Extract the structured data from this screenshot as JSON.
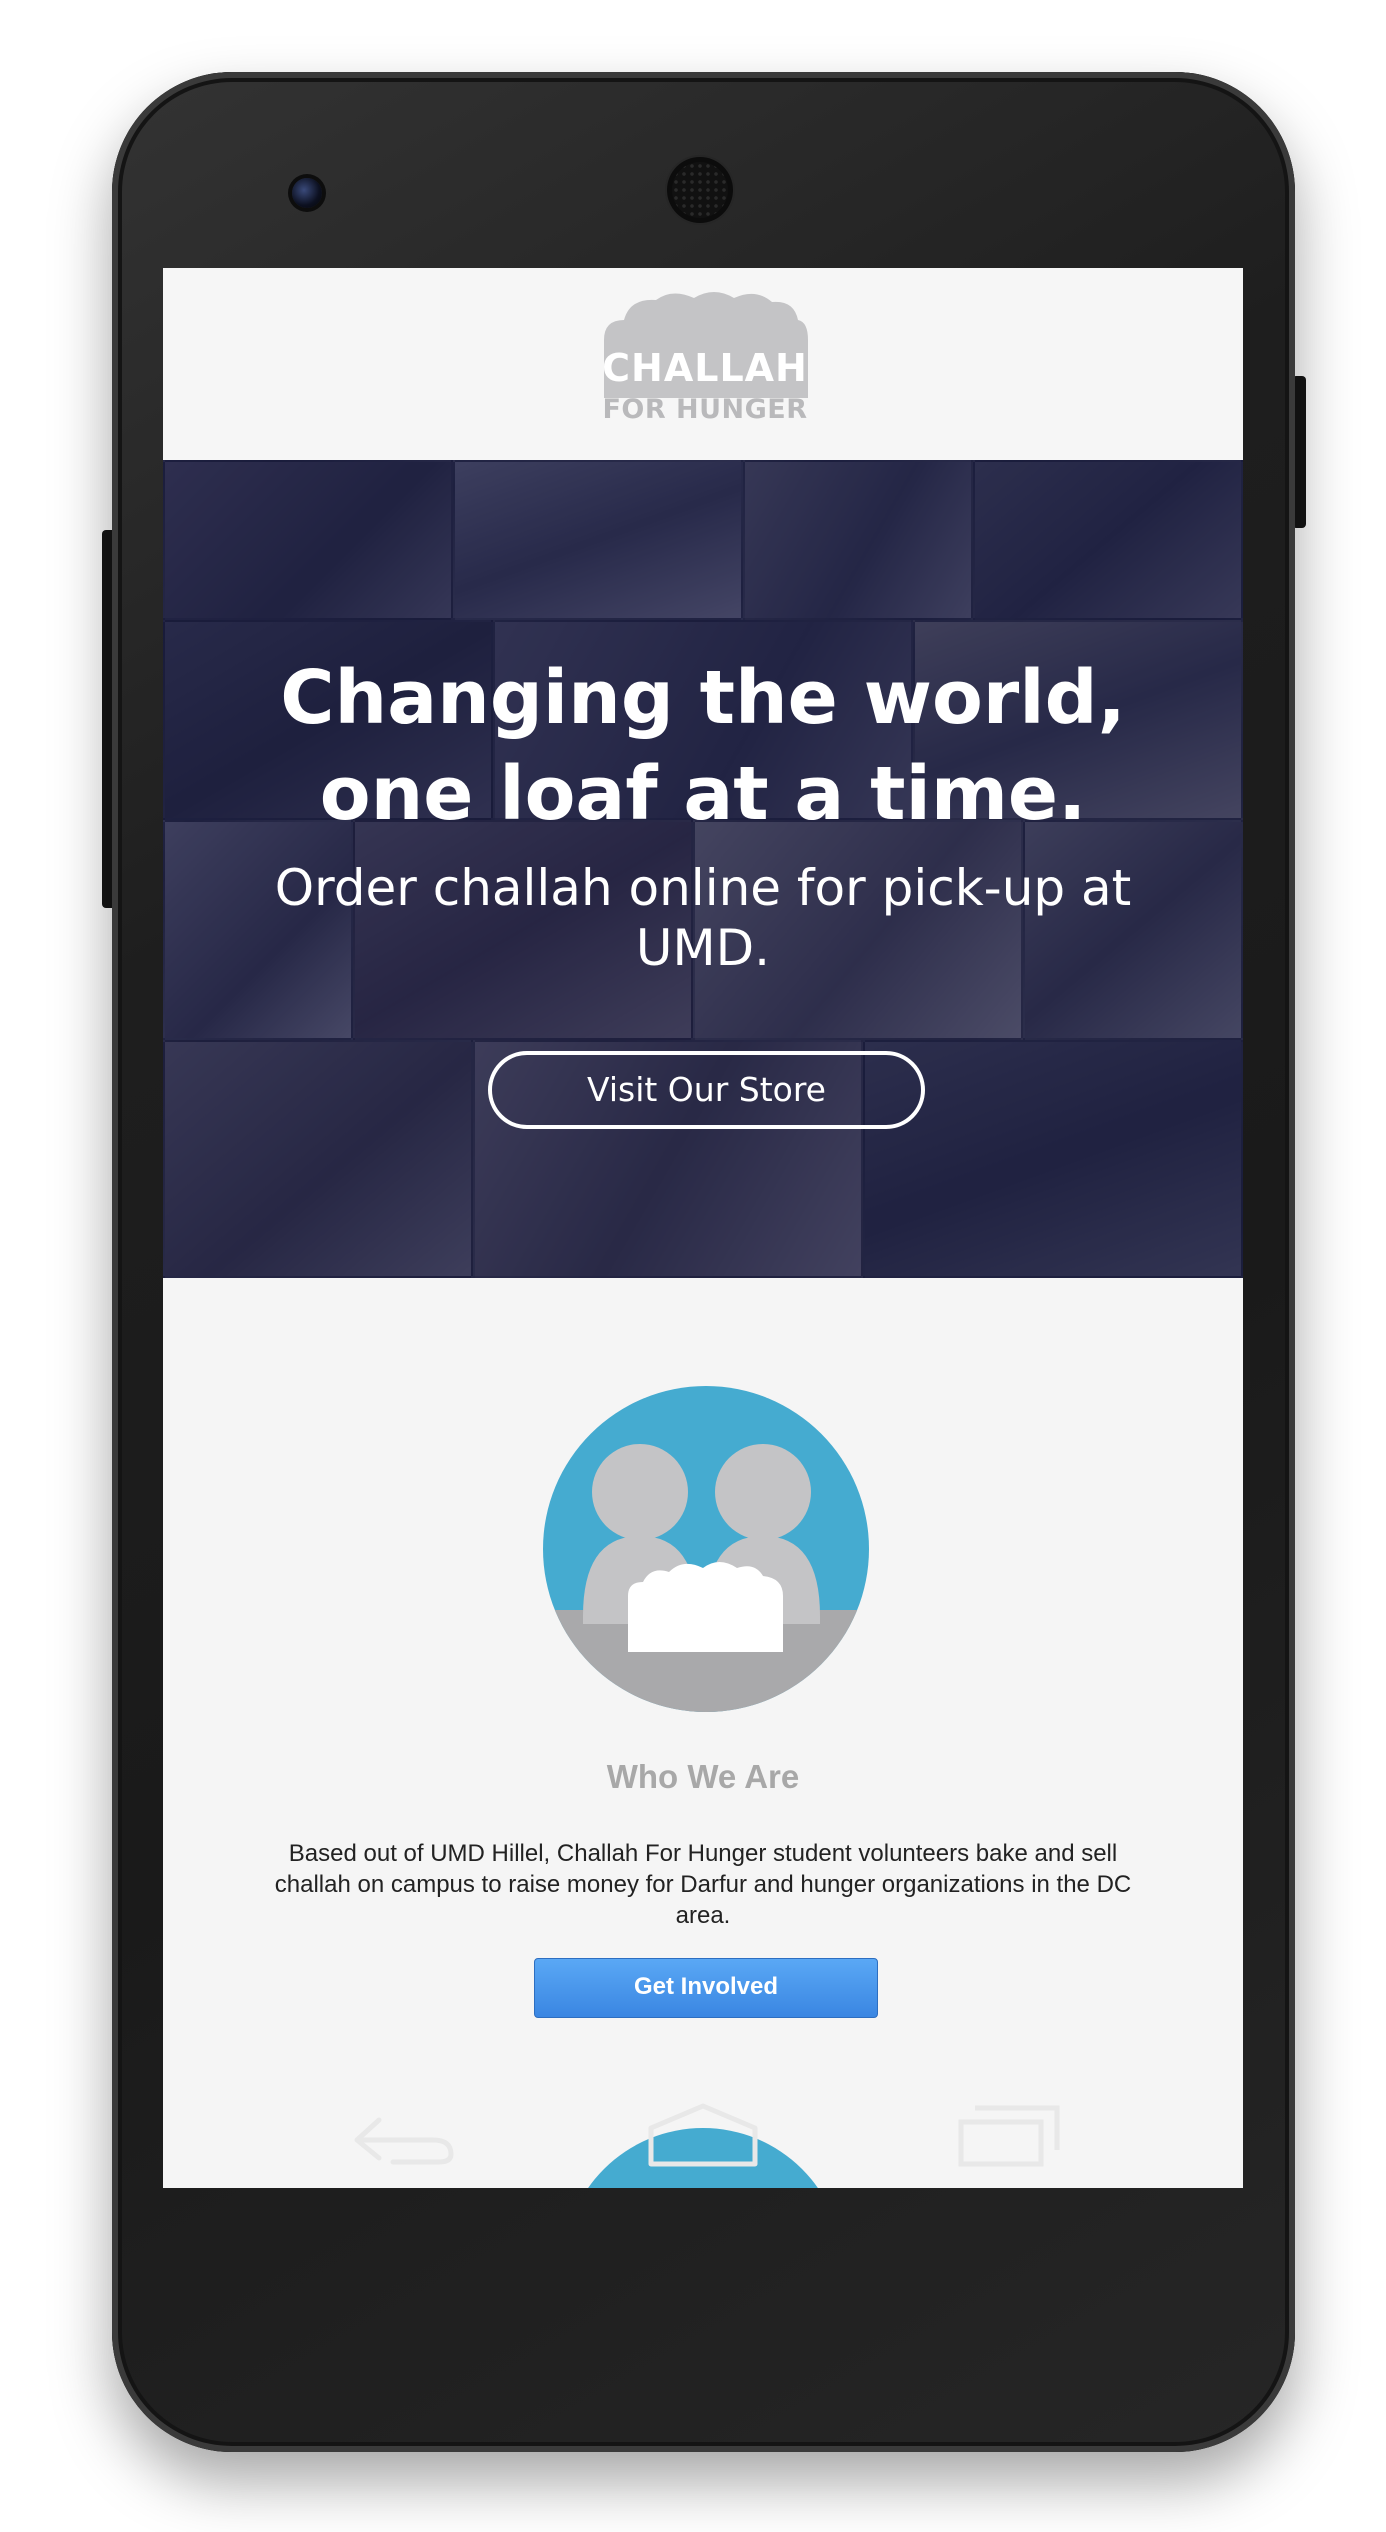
{
  "header": {
    "logo_line1": "CHALLAH",
    "logo_line2": "FOR HUNGER"
  },
  "hero": {
    "title_line1": "Changing the world,",
    "title_line2": "one loaf at a time.",
    "subtitle": "Order challah online for pick-up at UMD.",
    "store_button": "Visit Our Store"
  },
  "who_we_are": {
    "title": "Who We Are",
    "body": "Based out of UMD Hillel, Challah For Hunger student volunteers bake and sell challah on campus to raise money for Darfur and hunger organizations in the DC area.",
    "button": "Get Involved"
  },
  "navbar": {
    "icons": [
      "back-icon",
      "home-icon",
      "recent-apps-icon"
    ]
  },
  "colors": {
    "hero_overlay": "#181b42",
    "accent_blue": "#45abd0",
    "button_blue": "#4a97ec",
    "logo_gray": "#b9b9bb",
    "section_title_gray": "#a8a8a8"
  }
}
